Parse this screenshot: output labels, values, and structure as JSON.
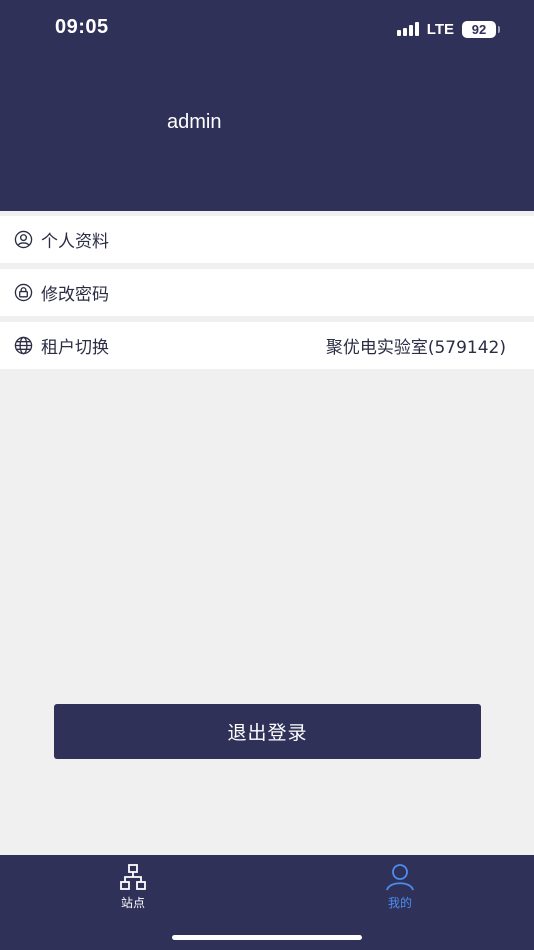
{
  "status_bar": {
    "time": "09:05",
    "network": "LTE",
    "battery": "92"
  },
  "header": {
    "username": "admin"
  },
  "menu": {
    "items": [
      {
        "label": "个人资料",
        "icon": "user-circle-icon"
      },
      {
        "label": "修改密码",
        "icon": "lock-icon"
      },
      {
        "label": "租户切换",
        "icon": "globe-icon",
        "value": "聚优电实验室(579142)"
      }
    ]
  },
  "logout_label": "退出登录",
  "tabbar": {
    "tabs": [
      {
        "label": "站点",
        "icon": "sitemap-icon",
        "active": false
      },
      {
        "label": "我的",
        "icon": "user-icon",
        "active": true
      }
    ],
    "active_color": "#4a8ef0"
  },
  "colors": {
    "primary": "#2f3159",
    "background": "#f0f0f0"
  }
}
